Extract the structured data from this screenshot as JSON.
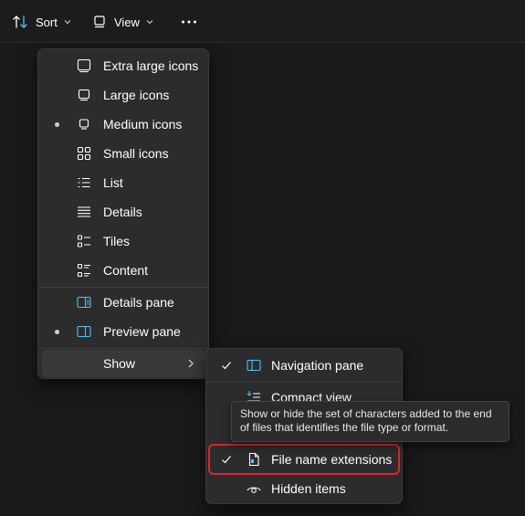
{
  "toolbar": {
    "sort_label": "Sort",
    "view_label": "View",
    "more_icon": "more-horizontal-icon"
  },
  "view_menu": {
    "items": [
      {
        "label": "Extra large icons",
        "icon": "extra-large-icons-icon",
        "selected": false
      },
      {
        "label": "Large icons",
        "icon": "large-icons-icon",
        "selected": false
      },
      {
        "label": "Medium icons",
        "icon": "medium-icons-icon",
        "selected": true
      },
      {
        "label": "Small icons",
        "icon": "small-icons-icon",
        "selected": false
      },
      {
        "label": "List",
        "icon": "list-icon",
        "selected": false
      },
      {
        "label": "Details",
        "icon": "details-icon",
        "selected": false
      },
      {
        "label": "Tiles",
        "icon": "tiles-icon",
        "selected": false
      },
      {
        "label": "Content",
        "icon": "content-icon",
        "selected": false
      }
    ],
    "panes": [
      {
        "label": "Details pane",
        "icon": "details-pane-icon",
        "selected": false
      },
      {
        "label": "Preview pane",
        "icon": "preview-pane-icon",
        "selected": true
      }
    ],
    "show_label": "Show"
  },
  "show_menu": {
    "items": [
      {
        "label": "Navigation pane",
        "icon": "navigation-pane-icon",
        "checked": true
      },
      {
        "label": "Compact view",
        "icon": "compact-view-icon",
        "checked": false
      },
      {
        "label": "File name extensions",
        "icon": "file-extension-icon",
        "checked": true
      },
      {
        "label": "Hidden items",
        "icon": "hidden-items-icon",
        "checked": false
      }
    ]
  },
  "tooltip": {
    "text": "Show or hide the set of characters added to the end of files that identifies the file type or format."
  },
  "colors": {
    "accent": "#4cc2ff",
    "highlight_box": "#e0232e",
    "menu_bg": "#2c2c2c",
    "page_bg": "#191919"
  }
}
